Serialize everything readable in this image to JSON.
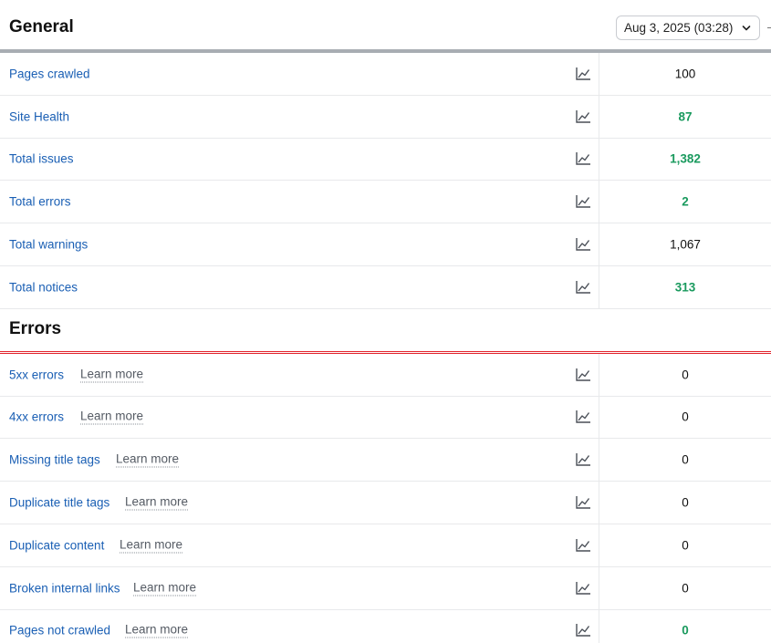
{
  "general": {
    "title": "General",
    "date_select": "Aug 3, 2025 (03:28)",
    "rows": [
      {
        "label": "Pages crawled",
        "value": "100",
        "status": "neutral"
      },
      {
        "label": "Site Health",
        "value": "87",
        "status": "good"
      },
      {
        "label": "Total issues",
        "value": "1,382",
        "status": "good"
      },
      {
        "label": "Total errors",
        "value": "2",
        "status": "good"
      },
      {
        "label": "Total warnings",
        "value": "1,067",
        "status": "neutral"
      },
      {
        "label": "Total notices",
        "value": "313",
        "status": "good"
      }
    ]
  },
  "errors": {
    "title": "Errors",
    "learn_more": "Learn more",
    "rows": [
      {
        "label": "5xx errors",
        "value": "0",
        "status": "neutral"
      },
      {
        "label": "4xx errors",
        "value": "0",
        "status": "neutral"
      },
      {
        "label": "Missing title tags",
        "value": "0",
        "status": "neutral"
      },
      {
        "label": "Duplicate title tags",
        "value": "0",
        "status": "neutral"
      },
      {
        "label": "Duplicate content",
        "value": "0",
        "status": "neutral"
      },
      {
        "label": "Broken internal links",
        "value": "0",
        "status": "neutral"
      },
      {
        "label": "Pages not crawled",
        "value": "0",
        "status": "good"
      }
    ]
  },
  "icons": {
    "trend": "line-chart-icon",
    "dropdown": "chevron-down-icon"
  },
  "colors": {
    "link": "#1a5fb4",
    "good": "#1a9a5e",
    "error_rule": "#e2242c",
    "general_rule": "#a8adb3"
  }
}
